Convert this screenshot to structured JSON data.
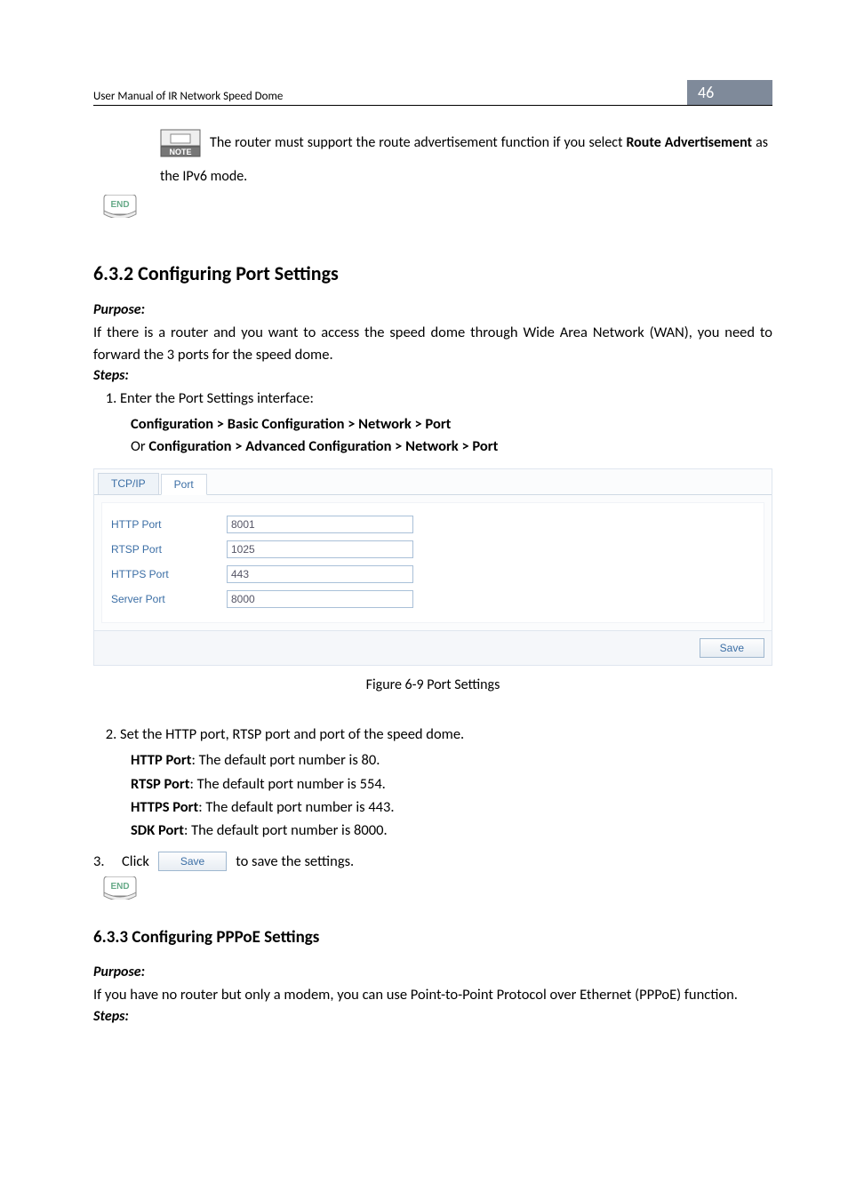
{
  "header": {
    "title": "User Manual of IR Network Speed Dome",
    "page_number": "46"
  },
  "section1": {
    "note_text": "The router must support the route advertisement function if you select ",
    "note_bold1": "Route Advertisement",
    "note_tail": " as the IPv6 mode."
  },
  "heading_port": "6.3.2  Configuring Port Settings",
  "purpose_label": "Purpose:",
  "purpose_text": "If there is a router and you want to access the speed dome through Wide Area Network (WAN), you need to forward the 3 ports for the speed dome.",
  "steps_label": "Steps:",
  "step1_text": "Enter the Port Settings interface:",
  "step1_path1": "Configuration > Basic Configuration > Network > Port",
  "step1_or": "Or ",
  "step1_path2": "Configuration > Advanced Configuration > Network > Port",
  "tabs": {
    "tcpip": "TCP/IP",
    "port": "Port"
  },
  "form": {
    "http_label": "HTTP Port",
    "http_value": "8001",
    "rtsp_label": "RTSP Port",
    "rtsp_value": "1025",
    "https_label": "HTTPS Port",
    "https_value": "443",
    "server_label": "Server Port",
    "server_value": "8000",
    "save": "Save"
  },
  "figure_caption": "Figure 6-9 Port Settings",
  "step2_lead": "Set the HTTP port, RTSP port and port of the speed dome.",
  "step2_lines": {
    "l1a": "HTTP Port",
    "l1b": ": The default port number is 80.",
    "l2a": "RTSP Port",
    "l2b": ": The default port number is 554.",
    "l3a": "HTTPS Port",
    "l3b": ": The default port number is 443.",
    "l4a": "SDK Port",
    "l4b": ": The default port number is 8000."
  },
  "step3": {
    "prefix": "3.",
    "click": "Click",
    "btn": "Save",
    "suffix": " to save the settings."
  },
  "heading_ppp": "6.3.3  Configuring PPPoE Settings",
  "ppp_purpose": "If you have no router but only a modem, you can use Point-to-Point Protocol over Ethernet (PPPoE) function."
}
